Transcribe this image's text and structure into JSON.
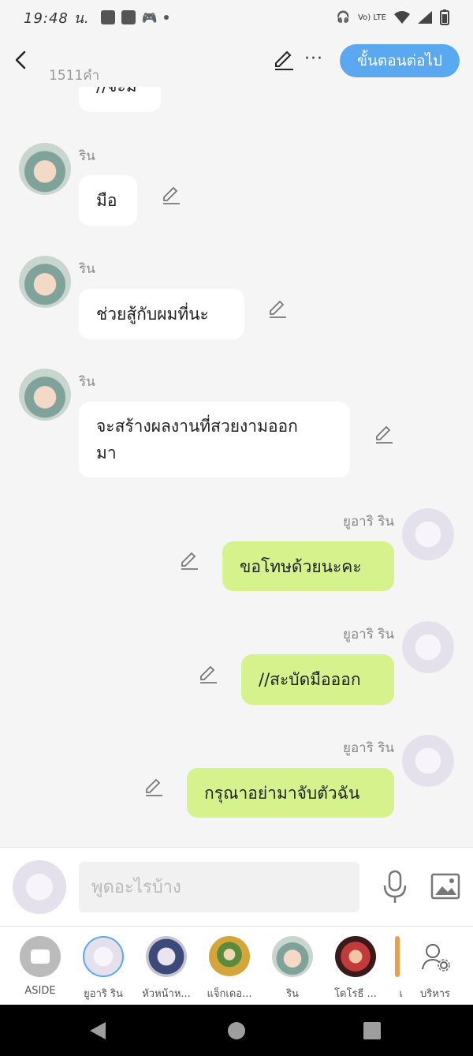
{
  "status_bar": {
    "time": "19:48 น.",
    "network": "Vo) LTE"
  },
  "header": {
    "word_count": "1511คำ",
    "next_label": "ขั้นตอนต่อไป"
  },
  "chat": {
    "partial_text": "//จะม",
    "messages": [
      {
        "side": "left",
        "name": "ริน",
        "text": "มือ"
      },
      {
        "side": "left",
        "name": "ริน",
        "text": "ช่วยสู้กับผมที่นะ"
      },
      {
        "side": "left",
        "name": "ริน",
        "line1": "จะสร้างผลงานที่สวยงามออก",
        "line2": "มา"
      },
      {
        "side": "right",
        "name": "ยูอาริ ริน",
        "text": "ขอโทษด้วยนะคะ"
      },
      {
        "side": "right",
        "name": "ยูอาริ ริน",
        "text": "//สะบัดมือออก"
      },
      {
        "side": "right",
        "name": "ยูอาริ ริน",
        "text": "กรุณาอย่ามาจับตัวฉัน"
      }
    ]
  },
  "input": {
    "placeholder": "พูดอะไรบ้าง"
  },
  "characters": [
    {
      "label": "ASIDE"
    },
    {
      "label": "ยูอาริ ริน"
    },
    {
      "label": "หัวหน้าห..."
    },
    {
      "label": "แจ็กเดอ..."
    },
    {
      "label": "ริน"
    },
    {
      "label": "โดโรธี ..."
    },
    {
      "label": "เ"
    },
    {
      "label": "บริหาร"
    }
  ],
  "colors": {
    "accent": "#5aa9f0",
    "bubble_right": "#d5f28c",
    "bubble_left": "#ffffff"
  }
}
